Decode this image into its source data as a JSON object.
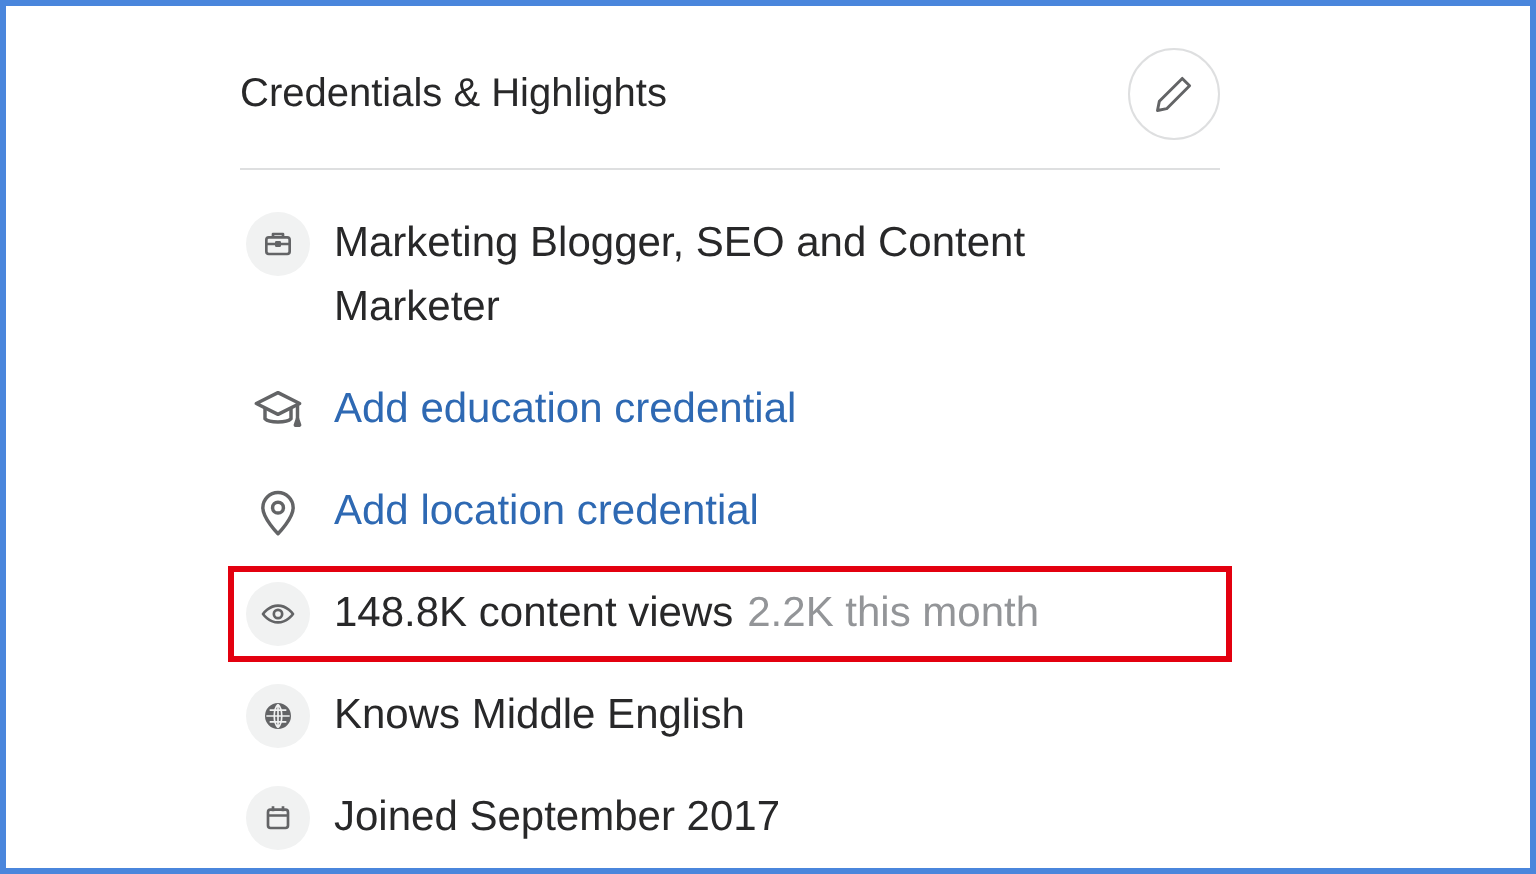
{
  "section": {
    "title": "Credentials & Highlights"
  },
  "items": [
    {
      "kind": "work",
      "text": "Marketing Blogger, SEO and Content Marketer",
      "link": false,
      "highlighted": false
    },
    {
      "kind": "education",
      "text": "Add education credential",
      "link": true,
      "highlighted": false
    },
    {
      "kind": "location",
      "text": "Add location credential",
      "link": true,
      "highlighted": false
    },
    {
      "kind": "views",
      "text": "148.8K content views",
      "secondary": "2.2K this month",
      "link": false,
      "highlighted": true
    },
    {
      "kind": "language",
      "text": "Knows Middle English",
      "link": false,
      "highlighted": false
    },
    {
      "kind": "joined",
      "text": "Joined September 2017",
      "link": false,
      "highlighted": false
    }
  ]
}
